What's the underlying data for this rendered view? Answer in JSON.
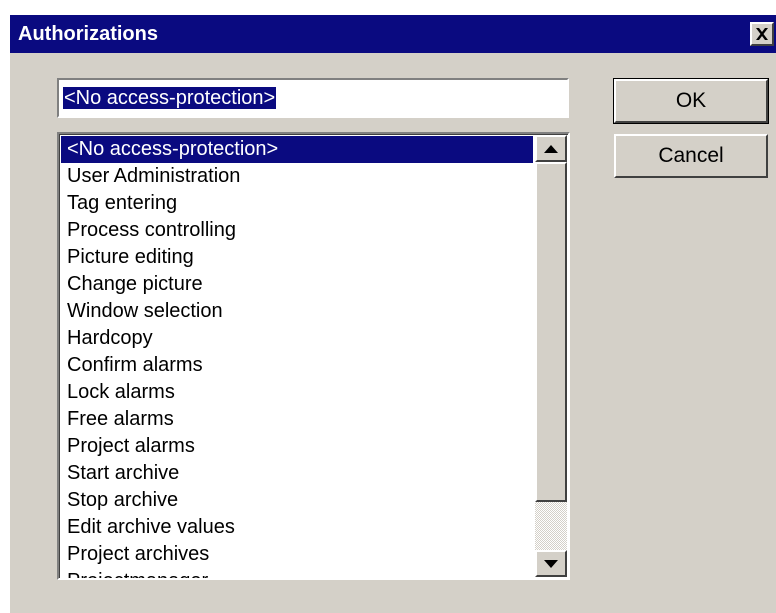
{
  "window": {
    "title": "Authorizations",
    "close_icon": "close-x-icon"
  },
  "input": {
    "value": "<No access-protection>"
  },
  "buttons": {
    "ok_label": "OK",
    "cancel_label": "Cancel"
  },
  "list": {
    "selected_index": 0,
    "items": [
      "<No access-protection>",
      "User Administration",
      "Tag entering",
      "Process controlling",
      "Picture editing",
      "Change picture",
      "Window selection",
      "Hardcopy",
      "Confirm alarms",
      "Lock alarms",
      "Free alarms",
      "Project alarms",
      "Start archive",
      "Stop archive",
      "Edit archive values",
      "Project archives",
      "Projectmanager"
    ]
  },
  "scrollbar": {
    "up_icon": "scroll-up-arrow-icon",
    "down_icon": "scroll-down-arrow-icon"
  },
  "colors": {
    "title_bar": "#0a0a80",
    "selection": "#0a0a80",
    "face": "#d4d0c8"
  }
}
